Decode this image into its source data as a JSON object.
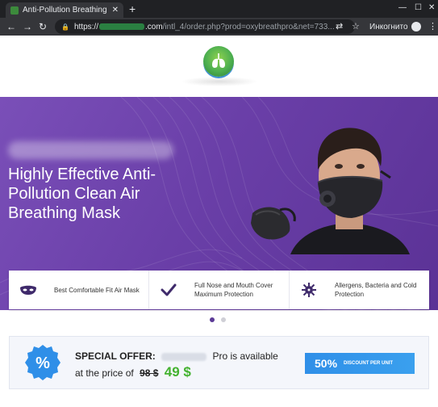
{
  "browser": {
    "tab_title": "Anti-Pollution Breathing M...",
    "tab_close": "✕",
    "new_tab": "+",
    "win_min": "—",
    "win_max": "☐",
    "win_close": "✕",
    "back": "←",
    "forward": "→",
    "reload": "↻",
    "url_prefix": "https://",
    "url_domain_end": ".com",
    "url_path": "/intl_4/order.php?prod=oxybreathpro&net=733...",
    "incognito_label": "Инкогнито",
    "icons": [
      "translate-icon",
      "star-icon",
      "menu-icon"
    ]
  },
  "hero": {
    "title": "Highly Effective Anti-Pollution Clean Air Breathing Mask"
  },
  "features": [
    {
      "icon": "mask-icon",
      "text": "Best Comfortable Fit Air Mask"
    },
    {
      "icon": "checkmark-icon",
      "text": "Full Nose and Mouth Cover Maximum Protection"
    },
    {
      "icon": "virus-icon",
      "text": "Allergens, Bacteria and Cold Protection"
    }
  ],
  "carousel": {
    "active": 0,
    "count": 2
  },
  "offer": {
    "label": "SPECIAL OFFER:",
    "available_text": "Pro is available",
    "price_prefix": "at the price of",
    "old_price": "98 $",
    "new_price": "49 $",
    "badge_symbol": "%",
    "discount_percent": "50%",
    "discount_label": "DISCOUNT PER UNIT"
  },
  "colors": {
    "hero_purple": "#6a3fa8",
    "price_green": "#43b22f",
    "discount_blue": "#2f8fe8",
    "badge_blue": "#2f8fe8"
  }
}
